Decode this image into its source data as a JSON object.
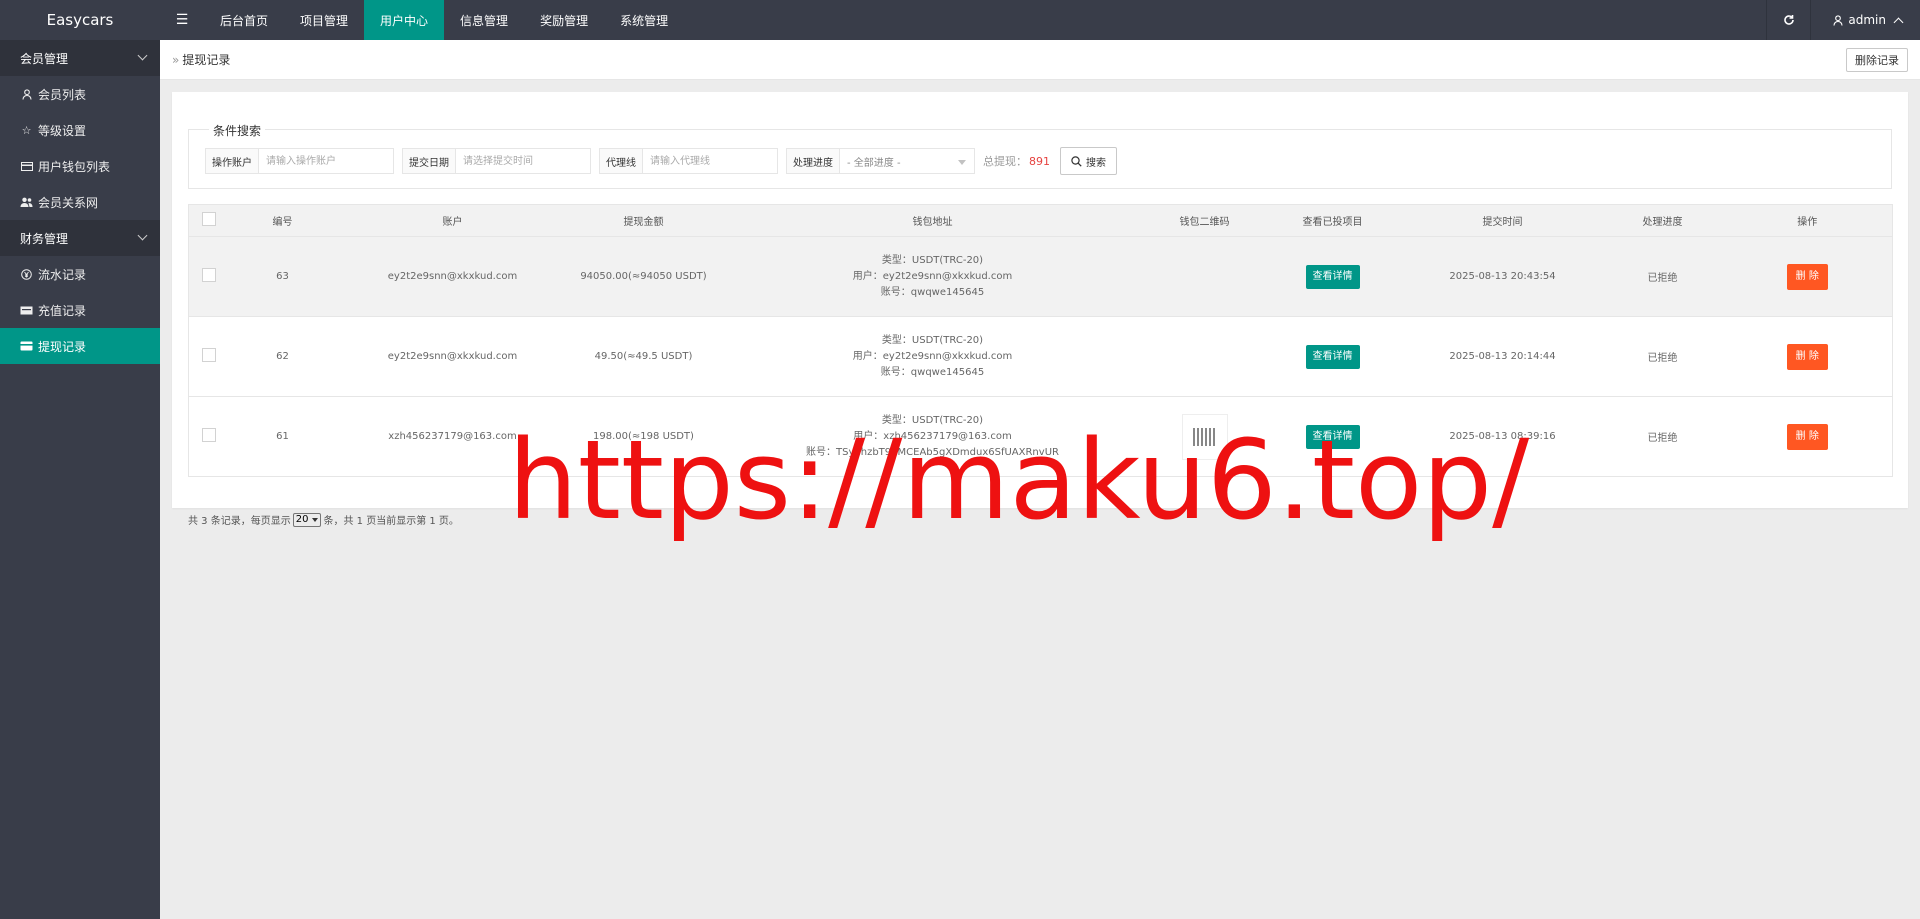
{
  "app": {
    "title": "Easycars"
  },
  "topnav": {
    "toggle_icon": "☰",
    "items": [
      "后台首页",
      "项目管理",
      "用户中心",
      "信息管理",
      "奖励管理",
      "系统管理"
    ],
    "active": "用户中心",
    "user": "admin"
  },
  "sidebar": {
    "groups": [
      {
        "label": "会员管理",
        "items": [
          "会员列表",
          "等级设置",
          "用户钱包列表",
          "会员关系网"
        ]
      },
      {
        "label": "财务管理",
        "items": [
          "流水记录",
          "充值记录",
          "提现记录"
        ]
      }
    ],
    "active": "提现记录"
  },
  "breadcrumb": {
    "current": "提现记录",
    "clear_label": "删除记录"
  },
  "search": {
    "legend": "条件搜索",
    "account_label": "操作账户",
    "account_placeholder": "请输入操作账户",
    "date_label": "提交日期",
    "date_placeholder": "请选择提交时间",
    "agent_label": "代理线",
    "agent_placeholder": "请输入代理线",
    "status_label": "处理进度",
    "status_value": "- 全部进度 -",
    "total_label": "总提现：",
    "total_value": "891",
    "search_label": "搜索"
  },
  "table": {
    "headers": [
      "编号",
      "账户",
      "提现金额",
      "钱包地址",
      "钱包二维码",
      "查看已投项目",
      "提交时间",
      "处理进度",
      "操作"
    ],
    "detail_label": "查看详情",
    "delete_label": "删 除",
    "rows": [
      {
        "id": "63",
        "account": "ey2t2e9snn@xkxkud.com",
        "amount": "94050.00(≈94050 USDT)",
        "wallet_type": "类型：USDT(TRC-20)",
        "wallet_user": "用户：ey2t2e9snn@xkxkud.com",
        "wallet_no": "账号：qwqwe145645",
        "has_qr": false,
        "time": "2025-08-13 20:43:54",
        "status": "已拒绝"
      },
      {
        "id": "62",
        "account": "ey2t2e9snn@xkxkud.com",
        "amount": "49.50(≈49.5 USDT)",
        "wallet_type": "类型：USDT(TRC-20)",
        "wallet_user": "用户：ey2t2e9snn@xkxkud.com",
        "wallet_no": "账号：qwqwe145645",
        "has_qr": false,
        "time": "2025-08-13 20:14:44",
        "status": "已拒绝"
      },
      {
        "id": "61",
        "account": "xzh456237179@163.com",
        "amount": "198.00(≈198 USDT)",
        "wallet_type": "类型：USDT(TRC-20)",
        "wallet_user": "用户：xzh456237179@163.com",
        "wallet_no": "账号：TSybhzbT91MCEAb5gXDmdux6SfUAXRnvUR",
        "has_qr": true,
        "time": "2025-08-13 08:39:16",
        "status": "已拒绝"
      }
    ]
  },
  "pager": {
    "prefix": "共 3 条记录，每页显示",
    "page_size": "20",
    "suffix": "条，共 1 页当前显示第 1 页。"
  },
  "watermark": "https://maku6.top/",
  "colors": {
    "accent": "#009688",
    "danger": "#ff5722",
    "header_bg": "#393d49",
    "total": "#e64340",
    "watermark": "#ee1111"
  }
}
